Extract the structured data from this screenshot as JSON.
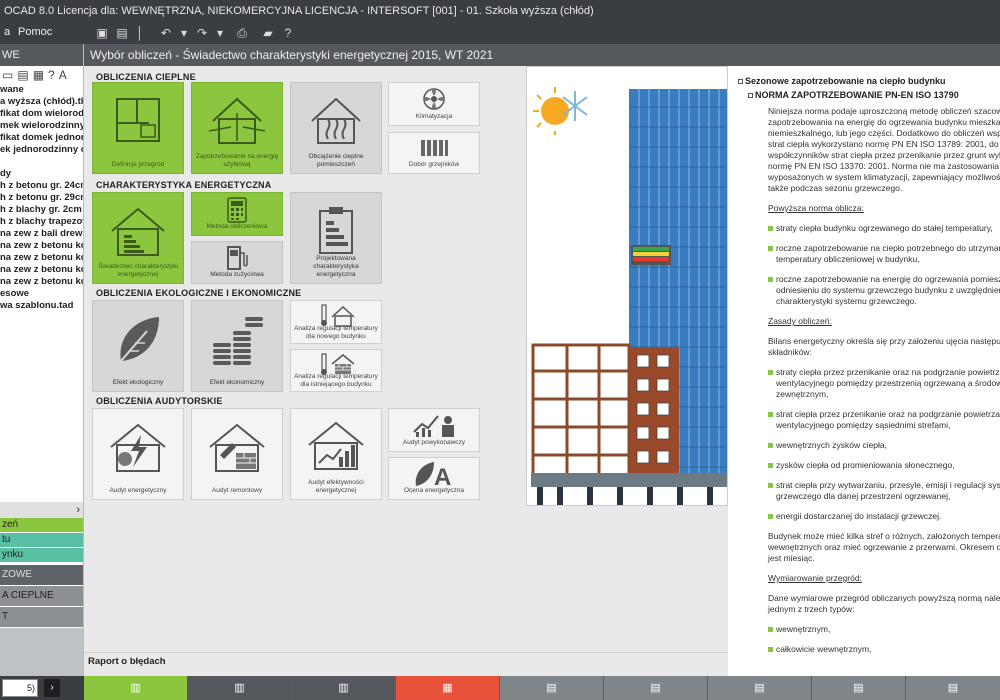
{
  "window": {
    "title": "OCAD 8.0 Licencja dla: WEWNĘTRZNA, NIEKOMERCYJNA LICENCJA - INTERSOFT [001] - 01. Szkoła wyższa (chłód)"
  },
  "menu": {
    "item1": "a",
    "item2": "Pomoc"
  },
  "header": {
    "title": "Wybór obliczeń - Świadectwo charakterystyki energetycznej 2015, WT 2021"
  },
  "left": {
    "header": "WE",
    "tree": [
      "wane",
      "a wyższa (chłód).thi",
      "fikat dom wieloroda",
      "mek wielorodzinny.t",
      "fikat domek jednoro",
      "ek jednorodzinny ob",
      "",
      "dy",
      "h z betonu gr. 24cm",
      "h z betonu gr. 29cm",
      "h z blachy gr. 2cm z",
      "h z blachy trapezow",
      "na zew z bali drewni",
      "na zew z betonu ko",
      "na zew z betonu ko",
      "na zew z betonu ko",
      "na zew z betonu ko",
      "esowe",
      "wa szablonu.tad"
    ],
    "arrow": "›",
    "groups": [
      "zeń",
      "tu",
      "ynku"
    ],
    "dark_groups": [
      "ZOWE",
      "A CIEPLNE",
      "T"
    ],
    "page_box": "5)",
    "go": "›"
  },
  "sections": {
    "heat": "OBLICZENIA CIEPLNE",
    "energy": "CHARAKTERYSTYKA ENERGETYCZNA",
    "eco": "OBLICZENIA EKOLOGICZNE I EKONOMICZNE",
    "audit": "OBLICZENIA AUDYTORSKIE"
  },
  "tiles": {
    "definicje": "Definicje przegród",
    "zapotrzebowanie": "Zapotrzebowanie na energię użytkową",
    "obciazenie": "Obciążenie cieplne pomieszczeń",
    "klimatyzacja": "Klimatyzacja",
    "dobor": "Dobór grzejników",
    "swiadectwo": "Świadectwo charakterystyki energetycznej",
    "metoda_obl": "Metoda obliczeniowa",
    "metoda_zuz": "Metoda zużyciowa",
    "projektowana": "Projektowana charakterystyka energetyczna",
    "efekt_eko": "Efekt ekologiczny",
    "efekt_ekon": "Efekt ekonomiczny",
    "analiza_nowy": "Analiza regulacji temperatury dla nowego budynku",
    "analiza_ist": "Analiza regulacji temperatury dla istniejącego budynku",
    "audyt_en": "Audyt energetyczny",
    "audyt_rem": "Audyt remontowy",
    "audyt_ef": "Audyt efektywności energetycznej",
    "audyt_pow": "Audyt powykonawczy",
    "ocena": "Ocena energetyczna"
  },
  "right": {
    "h1": "Sezonowe zapotrzebowanie na ciepło budynku",
    "h2": "NORMA ZAPOTRZEBOWANIE PN-EN ISO 13790",
    "p1": [
      "Niniejsza norma podaje uproszczoną metodę obliczeń szacowa",
      "zapotrzebowania na energię do ogrzewania budynku mieszkan",
      "niemieszkalnego, lub jego części. Dodatkowo do obliczeń wspó",
      "strat ciepła wykorzystano normę PN EN ISO 13789: 2001, do ob",
      "współczynników strat ciepła przez przenikanie przez grunt wyko",
      "normę PN EN ISO 13370: 2001. Norma nie ma zastosowania do",
      "wyposażonych w system klimatyzacji, zapewniający możliwość c",
      "także podczas sezonu grzewczego."
    ],
    "u1": "Powyższa norma oblicza:",
    "b1": "straty ciepła budynku ogrzewanego do stałej temperatury,",
    "b2": [
      "roczne zapotrzebowanie na ciepło potrzebnego do utrzyman",
      "temperatury obliczeniowej w budynku,"
    ],
    "b3": [
      "roczne zapotrzebowanie na energię do ogrzewania pomiesz",
      "odniesieniu do systemu grzewczego budynku z uwzględnien",
      "charakterystyki systemu grzewczego."
    ],
    "u2": "Zasady obliczeń:",
    "p2": [
      "Bilans energetyczny określa się przy założeniu ujęcia następują",
      "składników:"
    ],
    "b4": [
      "straty ciepła przez przenikanie oraz na podgrzanie powietrza",
      "wentylacyjnego pomiędzy przestrzenią ogrzewaną a środowisk",
      "zewnętrznym,"
    ],
    "b5": [
      "strat ciepła przez przenikanie oraz na podgrzanie powietrza",
      "wentylacyjnego pomiędzy sąsiednimi strefami,"
    ],
    "b6": "wewnętrznych zysków ciepła,",
    "b7": "zysków ciepła od promieniowania słonecznego,",
    "b8": [
      "strat ciepła przy wytwarzaniu, przesyle, emisji i regulacji syste",
      "grzewczego dla danej przestrzeni ogrzewanej,"
    ],
    "b9": "energii dostarczanej do instalacji grzewczej.",
    "p3": [
      "Budynek może mieć kilka stref o różnych, założonych temperat",
      "wewnętrznych oraz mieć ogrzewanie z przerwami. Okresem obl",
      "jest miesiąc."
    ],
    "u3": "Wymiarowanie przegród:",
    "p4": [
      "Dane wymiarowe przegród obliczanych powyższą normą należy",
      "jednym z trzech typów:"
    ],
    "b10": "wewnętrznym,",
    "b11": "całkowicie wewnętrznym,"
  },
  "errbar": {
    "label": "Raport o błędach"
  },
  "colors": {
    "green": "#8cc63f",
    "orange_tab": "#e8513a",
    "dark": "#3a3d41"
  }
}
